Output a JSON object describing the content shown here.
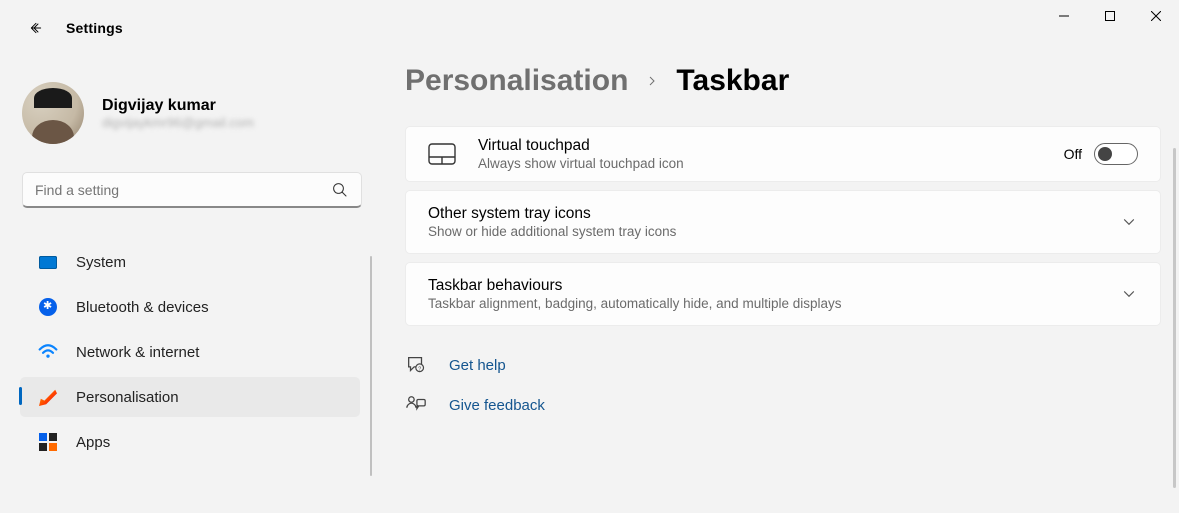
{
  "window": {
    "app_title": "Settings"
  },
  "user": {
    "name": "Digvijay kumar",
    "email_masked": "digvijaykmr96@gmail.com"
  },
  "search": {
    "placeholder": "Find a setting"
  },
  "nav": {
    "items": [
      {
        "id": "system",
        "label": "System"
      },
      {
        "id": "bluetooth",
        "label": "Bluetooth & devices"
      },
      {
        "id": "network",
        "label": "Network & internet"
      },
      {
        "id": "personalisation",
        "label": "Personalisation"
      },
      {
        "id": "apps",
        "label": "Apps"
      }
    ],
    "selected": "personalisation"
  },
  "breadcrumb": {
    "parent": "Personalisation",
    "current": "Taskbar"
  },
  "settings": {
    "virtual_touchpad": {
      "title": "Virtual touchpad",
      "subtitle": "Always show virtual touchpad icon",
      "state_label": "Off",
      "value": false
    },
    "other_tray": {
      "title": "Other system tray icons",
      "subtitle": "Show or hide additional system tray icons"
    },
    "behaviours": {
      "title": "Taskbar behaviours",
      "subtitle": "Taskbar alignment, badging, automatically hide, and multiple displays"
    }
  },
  "links": {
    "help": "Get help",
    "feedback": "Give feedback"
  }
}
